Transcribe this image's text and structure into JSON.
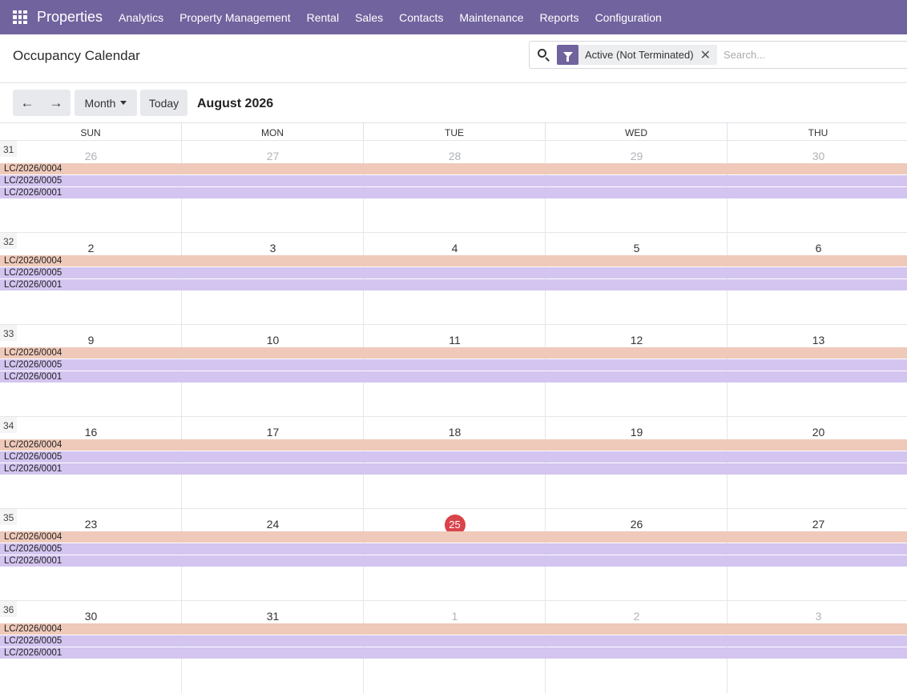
{
  "navbar": {
    "brand": "Properties",
    "menu": [
      "Analytics",
      "Property Management",
      "Rental",
      "Sales",
      "Contacts",
      "Maintenance",
      "Reports",
      "Configuration"
    ],
    "color": "#71639e"
  },
  "control_panel": {
    "title": "Occupancy Calendar",
    "facet_label": "Active (Not Terminated)",
    "facet_close": "✕",
    "search_placeholder": "Search..."
  },
  "toolbar": {
    "prev": "←",
    "next": "→",
    "scale": "Month",
    "today": "Today",
    "range_title": "August 2026"
  },
  "calendar": {
    "weekdays": [
      "SUN",
      "MON",
      "TUE",
      "WED",
      "THU"
    ],
    "weeks": [
      {
        "week_number": "31",
        "days": [
          {
            "n": "26",
            "other": true
          },
          {
            "n": "27",
            "other": true
          },
          {
            "n": "28",
            "other": true
          },
          {
            "n": "29",
            "other": true
          },
          {
            "n": "30",
            "other": true
          }
        ]
      },
      {
        "week_number": "32",
        "days": [
          {
            "n": "2"
          },
          {
            "n": "3"
          },
          {
            "n": "4"
          },
          {
            "n": "5"
          },
          {
            "n": "6"
          }
        ]
      },
      {
        "week_number": "33",
        "days": [
          {
            "n": "9"
          },
          {
            "n": "10"
          },
          {
            "n": "11"
          },
          {
            "n": "12"
          },
          {
            "n": "13"
          }
        ]
      },
      {
        "week_number": "34",
        "days": [
          {
            "n": "16"
          },
          {
            "n": "17"
          },
          {
            "n": "18"
          },
          {
            "n": "19"
          },
          {
            "n": "20"
          }
        ]
      },
      {
        "week_number": "35",
        "days": [
          {
            "n": "23"
          },
          {
            "n": "24"
          },
          {
            "n": "25",
            "today": true
          },
          {
            "n": "26"
          },
          {
            "n": "27"
          }
        ]
      },
      {
        "week_number": "36",
        "days": [
          {
            "n": "30"
          },
          {
            "n": "31"
          },
          {
            "n": "1",
            "other": true
          },
          {
            "n": "2",
            "other": true
          },
          {
            "n": "3",
            "other": true
          }
        ]
      }
    ],
    "events": [
      {
        "label": "LC/2026/0004",
        "color": "#efc9b9"
      },
      {
        "label": "LC/2026/0005",
        "color": "#d3c4f0"
      },
      {
        "label": "LC/2026/0001",
        "color": "#d3c4f0"
      }
    ],
    "today_color": "#d9434a"
  }
}
